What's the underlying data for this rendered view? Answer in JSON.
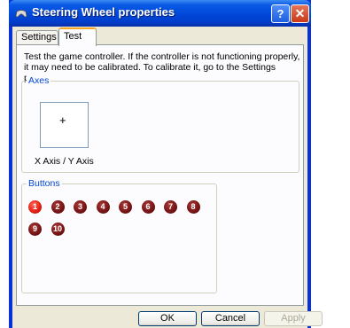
{
  "window": {
    "title": "Steering Wheel properties",
    "help_glyph": "?",
    "close_glyph": "✕"
  },
  "tabs": [
    {
      "label": "Settings",
      "selected": false
    },
    {
      "label": "Test",
      "selected": true
    }
  ],
  "test": {
    "description": "Test the game controller.  If the controller is not functioning properly, it may need to be calibrated.  To calibrate it, go to the Settings page.",
    "axes": {
      "label": "Axes",
      "crosshair": "+",
      "axis_caption": "X Axis / Y Axis"
    },
    "buttons": {
      "label": "Buttons",
      "items": [
        {
          "number": "1",
          "pressed": true
        },
        {
          "number": "2",
          "pressed": false
        },
        {
          "number": "3",
          "pressed": false
        },
        {
          "number": "4",
          "pressed": false
        },
        {
          "number": "5",
          "pressed": false
        },
        {
          "number": "6",
          "pressed": false
        },
        {
          "number": "7",
          "pressed": false
        },
        {
          "number": "8",
          "pressed": false
        },
        {
          "number": "9",
          "pressed": false
        },
        {
          "number": "10",
          "pressed": false
        }
      ]
    }
  },
  "footer": {
    "ok_label": "OK",
    "cancel_label": "Cancel",
    "apply_label": "Apply"
  },
  "colors": {
    "title_bar": "#0047d8",
    "group_label": "#0046d5",
    "button_idle": "#7a1515",
    "button_pressed": "#e01b10",
    "dialog_face": "#ece9d8"
  },
  "icons": {
    "title": "game-controller-icon",
    "help": "help-icon",
    "close": "close-icon"
  }
}
